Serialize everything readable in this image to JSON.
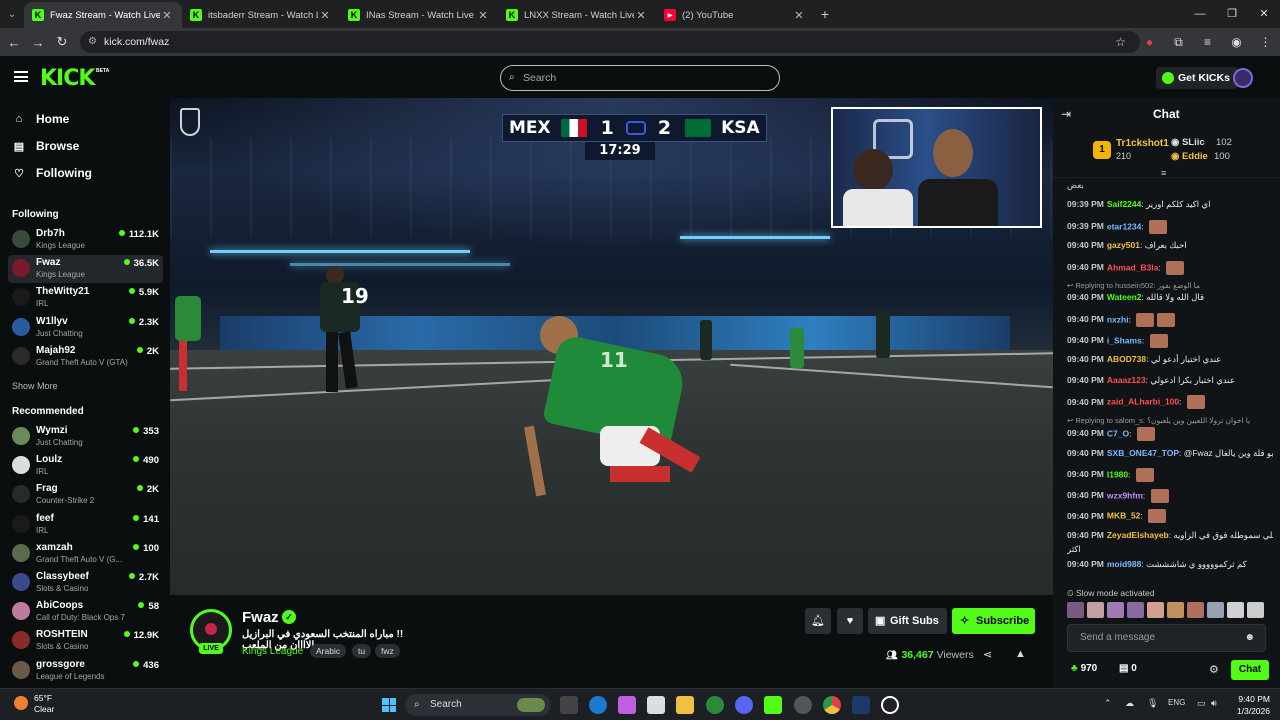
{
  "browser": {
    "tabs": [
      {
        "title": "Fwaz Stream - Watch Live on Kick",
        "icon": "kick-icon",
        "active": true
      },
      {
        "title": "itsbaderr Stream - Watch Live on Kick",
        "icon": "kick-icon",
        "active": false
      },
      {
        "title": "INas Stream - Watch Live on Kick",
        "icon": "kick-icon",
        "active": false
      },
      {
        "title": "LNXX Stream - Watch Live on Kick",
        "icon": "kick-icon",
        "active": false
      },
      {
        "title": "(2) YouTube",
        "icon": "youtube-icon",
        "active": false
      }
    ],
    "url": "kick.com/fwaz"
  },
  "header": {
    "logo": "KICK",
    "logo_badge": "BETA",
    "search_placeholder": "Search",
    "get_kicks": "Get KICKs"
  },
  "sidebar": {
    "nav": [
      {
        "label": "Home",
        "icon": "home-icon"
      },
      {
        "label": "Browse",
        "icon": "browse-icon"
      },
      {
        "label": "Following",
        "icon": "heart-icon"
      }
    ],
    "following_title": "Following",
    "following": [
      {
        "name": "Drb7h",
        "category": "Kings League",
        "viewers": "112.1K",
        "color": "#3a4a3a"
      },
      {
        "name": "Fwaz",
        "category": "Kings League",
        "viewers": "36.5K",
        "color": "#7a1a2a"
      },
      {
        "name": "TheWitty21",
        "category": "IRL",
        "viewers": "5.9K",
        "color": "#1a1a1a"
      },
      {
        "name": "W1llyv",
        "category": "Just Chatting",
        "viewers": "2.3K",
        "color": "#2a5aa0"
      },
      {
        "name": "Majah92",
        "category": "Grand Theft Auto V (GTA)",
        "viewers": "2K",
        "color": "#2a2a2a"
      }
    ],
    "show_more": "Show More",
    "recommended_title": "Recommended",
    "recommended": [
      {
        "name": "Wymzi",
        "category": "Just Chatting",
        "viewers": "353",
        "color": "#6a8a5a"
      },
      {
        "name": "Loulz",
        "category": "IRL",
        "viewers": "490",
        "color": "#dddddd"
      },
      {
        "name": "Frag",
        "category": "Counter-Strike 2",
        "viewers": "2K",
        "color": "#2a2a2a"
      },
      {
        "name": "feef",
        "category": "IRL",
        "viewers": "141",
        "color": "#1a1a1a"
      },
      {
        "name": "xamzah",
        "category": "Grand Theft Auto V (G...",
        "viewers": "100",
        "color": "#5a6a4a"
      },
      {
        "name": "Classybeef",
        "category": "Slots & Casino",
        "viewers": "2.7K",
        "color": "#3a4a8a"
      },
      {
        "name": "AbiCoops",
        "category": "Call of Duty: Black Ops 7",
        "viewers": "58",
        "color": "#c07aa0"
      },
      {
        "name": "ROSHTEIN",
        "category": "Slots & Casino",
        "viewers": "12.9K",
        "color": "#8a2a2a"
      },
      {
        "name": "grossgore",
        "category": "League of Legends",
        "viewers": "436",
        "color": "#6a5a4a"
      }
    ]
  },
  "video": {
    "team_left": "MEX",
    "team_right": "KSA",
    "score_left": "1",
    "score_right": "2",
    "clock": "17:29",
    "jersey_numbers": [
      "19",
      "11"
    ]
  },
  "stream": {
    "name": "Fwaz",
    "live_badge": "LIVE",
    "title": "!! مباراه المنتخب السعودي في البرازيل الاااان من الملعب",
    "category": "Kings League",
    "tags": [
      "Arabic",
      "tu",
      "fwz"
    ],
    "gift_subs": "Gift Subs",
    "subscribe": "Subscribe",
    "viewers": "36,467",
    "viewers_label": "Viewers"
  },
  "chat": {
    "title": "Chat",
    "pinned": [
      {
        "name": "Tr1ckshot1",
        "count": "210"
      },
      {
        "name": "SLiic",
        "count": "102"
      },
      {
        "name": "Eddie",
        "count": "100"
      }
    ],
    "top_fragment": "بعض",
    "messages": [
      {
        "time": "09:39 PM",
        "user": "Saif2244",
        "color": "#53fc18",
        "text": "اي اكيد كلكم اوزير"
      },
      {
        "time": "09:39 PM",
        "user": "etar1234",
        "color": "#7ab8ff",
        "text": ""
      },
      {
        "time": "09:40 PM",
        "user": "gazy501",
        "color": "#f0c040",
        "text": "احبك بعراف"
      },
      {
        "time": "09:40 PM",
        "user": "Ahmad_B3la",
        "color": "#ff4d4d",
        "text": ""
      },
      {
        "time": "09:40 PM",
        "user": "Wateen2",
        "color": "#53fc18",
        "text": "قال الله ولا قالله",
        "reply": "Replying to hussein502: ما الوضع بفوز"
      },
      {
        "time": "09:40 PM",
        "user": "nxzhi",
        "color": "#7ab8ff",
        "text": ""
      },
      {
        "time": "09:40 PM",
        "user": "i_Shams",
        "color": "#7ab8ff",
        "text": ""
      },
      {
        "time": "09:40 PM",
        "user": "ABOD738",
        "color": "#f0c040",
        "text": "عندي اختبار أدعو لي"
      },
      {
        "time": "09:40 PM",
        "user": "Aaaaz123",
        "color": "#ff4d4d",
        "text": "عندي اختبار بكرا ادعولي"
      },
      {
        "time": "09:40 PM",
        "user": "zaid_ALharbi_100",
        "color": "#ff4d4d",
        "text": ""
      },
      {
        "time": "09:40 PM",
        "user": "C7_O",
        "color": "#7ab8ff",
        "text": "",
        "reply": "Replying to salom_s: يا اخوان ترولا اللعبين وين يلعبون؟"
      },
      {
        "time": "09:40 PM",
        "user": "SXB_ONE47_TOP",
        "color": "#7ab8ff",
        "text": "@Fwaz ابو فلة وين يالغال"
      },
      {
        "time": "09:40 PM",
        "user": "I1980",
        "color": "#53fc18",
        "text": ""
      },
      {
        "time": "09:40 PM",
        "user": "wzx9hfm",
        "color": "#c08aff",
        "text": ""
      },
      {
        "time": "09:40 PM",
        "user": "MKB_52",
        "color": "#f0c040",
        "text": ""
      },
      {
        "time": "09:40 PM",
        "user": "ZeyadElshayeb",
        "color": "#f0c040",
        "text": "خلي سموطله فوق في الزاويه"
      },
      {
        "time": "09:40 PM",
        "user": "moid988",
        "color": "#7ab8ff",
        "text": "كم ثركمووووو ي شاشششت"
      }
    ],
    "wrap_fragment": "اكثر",
    "slow_mode": "Slow mode activated",
    "input_placeholder": "Send a message",
    "points": "970",
    "gifts": "0",
    "chat_button": "Chat"
  },
  "taskbar": {
    "temp": "65°F",
    "weather": "Clear",
    "search": "Search",
    "lang": "ENG",
    "time": "9:40 PM",
    "date": "1/3/2026"
  }
}
